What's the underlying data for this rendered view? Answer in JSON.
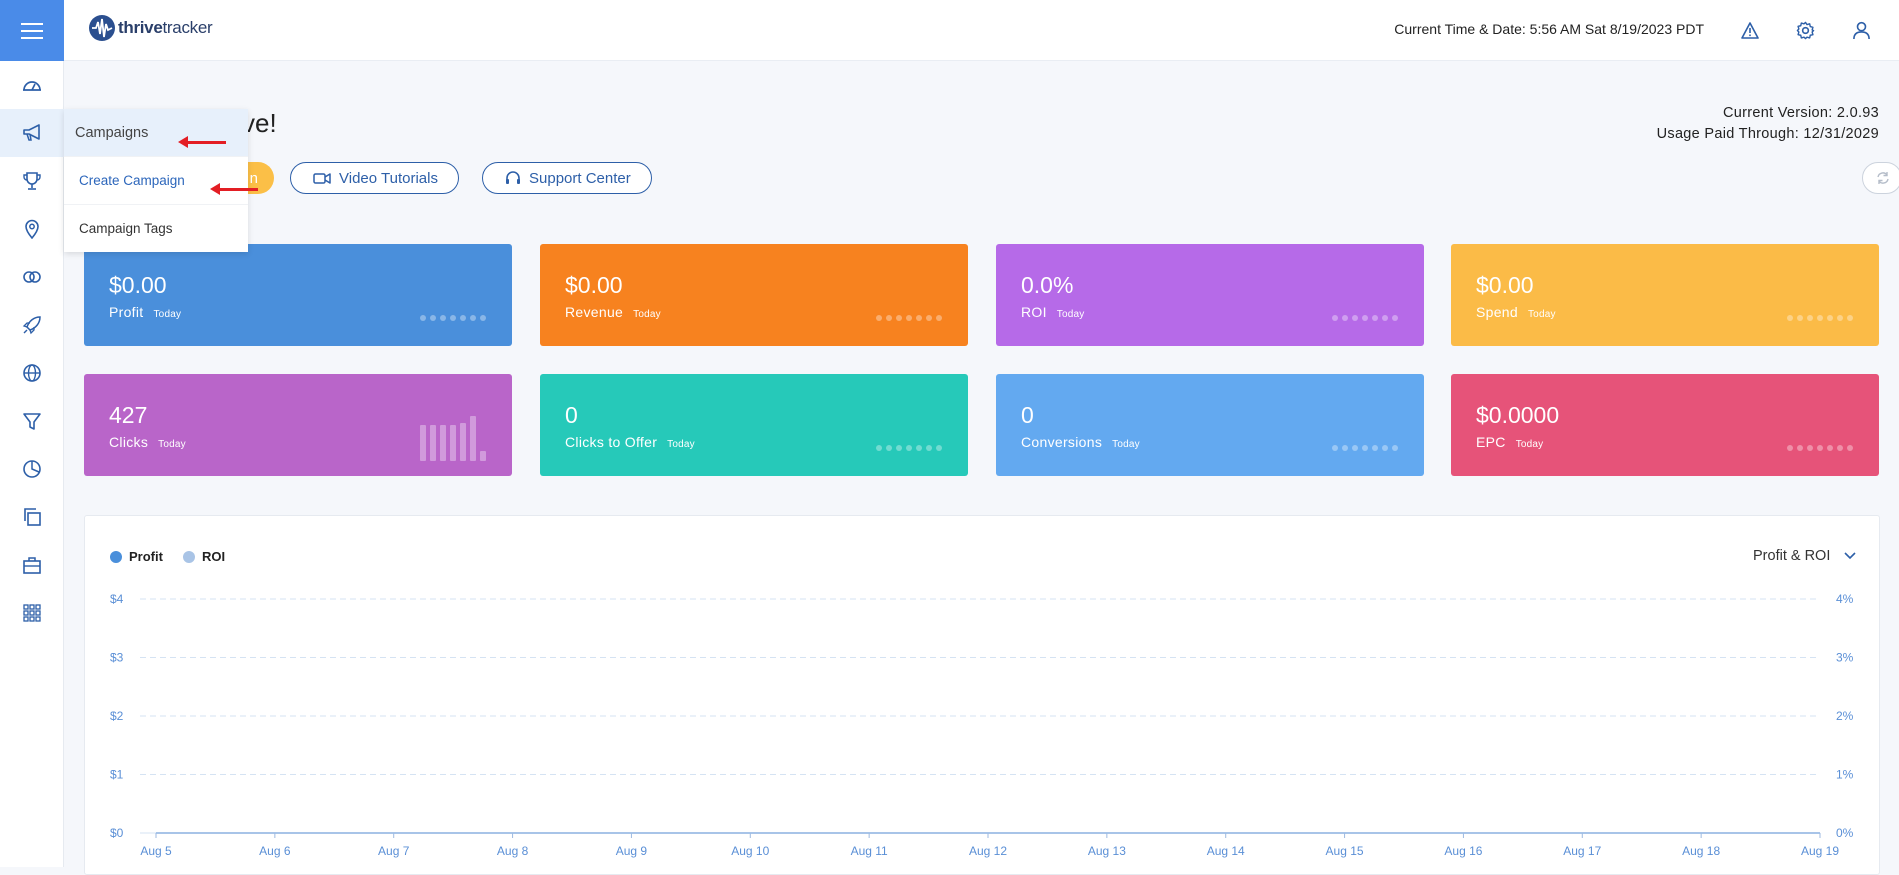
{
  "header": {
    "logo_text_a": "thrive",
    "logo_text_b": "tracker",
    "current_time": "Current Time & Date: 5:56 AM Sat 8/19/2023 PDT",
    "icons": [
      "warning-icon",
      "gear-icon",
      "user-icon"
    ]
  },
  "sidebar": {
    "items": [
      "dashboard-icon",
      "megaphone-icon",
      "trophy-icon",
      "location-pin-icon",
      "link-icon",
      "rocket-icon",
      "globe-icon",
      "funnel-icon",
      "pie-chart-icon",
      "copy-icon",
      "briefcase-icon",
      "grid-icon"
    ]
  },
  "flyout": {
    "title": "Campaigns",
    "items": [
      "Create Campaign",
      "Campaign Tags"
    ]
  },
  "welcome": {
    "text": "ve!"
  },
  "version": {
    "current": "Current Version: 2.0.93",
    "paid": "Usage Paid Through: 12/31/2029"
  },
  "buttons": {
    "partial": "n",
    "video_tutorials": "Video Tutorials",
    "support_center": "Support Center"
  },
  "cards": [
    {
      "value": "$0.00",
      "label": "Profit",
      "sub": "Today",
      "color": "#4a8fdb"
    },
    {
      "value": "$0.00",
      "label": "Revenue",
      "sub": "Today",
      "color": "#f7821f"
    },
    {
      "value": "0.0%",
      "label": "ROI",
      "sub": "Today",
      "color": "#b66ae8"
    },
    {
      "value": "$0.00",
      "label": "Spend",
      "sub": "Today",
      "color": "#fbbb47"
    },
    {
      "value": "427",
      "label": "Clicks",
      "sub": "Today",
      "color": "#b965c9"
    },
    {
      "value": "0",
      "label": "Clicks to Offer",
      "sub": "Today",
      "color": "#26c9b9"
    },
    {
      "value": "0",
      "label": "Conversions",
      "sub": "Today",
      "color": "#63a9f0"
    },
    {
      "value": "$0.0000",
      "label": "EPC",
      "sub": "Today",
      "color": "#e65379"
    }
  ],
  "chart_select": "Profit & ROI",
  "chart_data": {
    "type": "line",
    "x": [
      "Aug 5",
      "Aug 6",
      "Aug 7",
      "Aug 8",
      "Aug 9",
      "Aug 10",
      "Aug 11",
      "Aug 12",
      "Aug 13",
      "Aug 14",
      "Aug 15",
      "Aug 16",
      "Aug 17",
      "Aug 18",
      "Aug 19"
    ],
    "series": [
      {
        "name": "Profit",
        "values": [
          0,
          0,
          0,
          0,
          0,
          0,
          0,
          0,
          0,
          0,
          0,
          0,
          0,
          0,
          0
        ],
        "color": "#4a8fdb"
      },
      {
        "name": "ROI",
        "values": [
          0,
          0,
          0,
          0,
          0,
          0,
          0,
          0,
          0,
          0,
          0,
          0,
          0,
          0,
          0
        ],
        "color": "#a9c4e6"
      }
    ],
    "y_left_ticks": [
      "$0",
      "$1",
      "$2",
      "$3",
      "$4"
    ],
    "y_right_ticks": [
      "0%",
      "1%",
      "2%",
      "3%",
      "4%"
    ],
    "ylim": [
      0,
      4
    ],
    "y2lim": [
      0,
      4
    ],
    "grid": true,
    "legend": "top-left"
  }
}
